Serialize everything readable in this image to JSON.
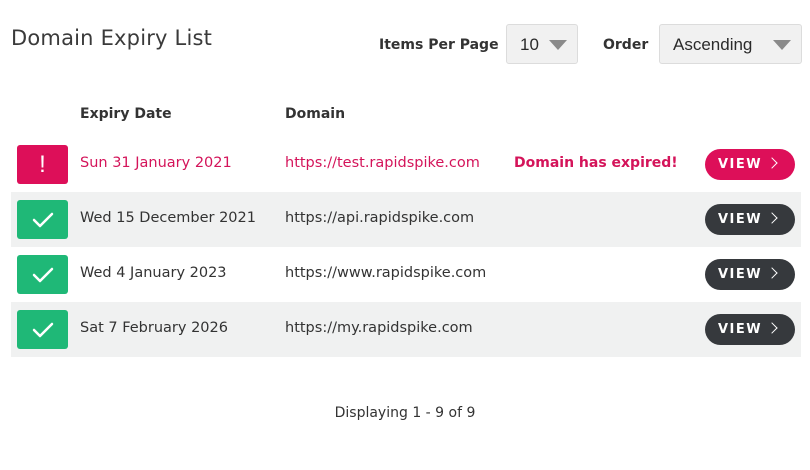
{
  "header": {
    "title": "Domain Expiry List",
    "items_per_page_label": "Items Per Page",
    "items_per_page_value": "10",
    "order_label": "Order",
    "order_value": "Ascending"
  },
  "table": {
    "columns": [
      "Expiry Date",
      "Domain"
    ],
    "rows": [
      {
        "status": "expired",
        "date": "Sun 31 January 2021",
        "domain": "https://test.rapidspike.com",
        "message": "Domain has expired!",
        "action": "VIEW"
      },
      {
        "status": "ok",
        "date": "Wed 15 December 2021",
        "domain": "https://api.rapidspike.com",
        "message": "",
        "action": "VIEW"
      },
      {
        "status": "ok",
        "date": "Wed 4 January 2023",
        "domain": "https://www.rapidspike.com",
        "message": "",
        "action": "VIEW"
      },
      {
        "status": "ok",
        "date": "Sat 7 February 2026",
        "domain": "https://my.rapidspike.com",
        "message": "",
        "action": "VIEW"
      }
    ]
  },
  "footer": {
    "pagination_text": "Displaying 1 - 9 of 9"
  },
  "colors": {
    "danger": "#dd0f59",
    "success": "#1fb877",
    "dark_button": "#36393d",
    "alt_row": "#f0f1f1"
  },
  "icons": {
    "expired": "exclamation-icon",
    "ok": "checkmark-icon",
    "button": "chevron-right-icon"
  }
}
